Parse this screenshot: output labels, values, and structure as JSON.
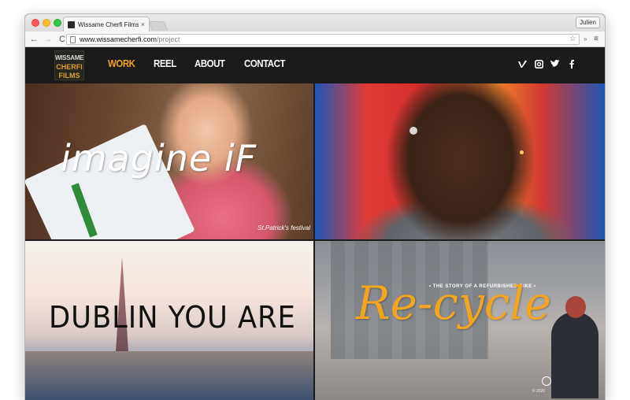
{
  "browser": {
    "tab_title": "Wissame Cherfi Films",
    "tab_close": "×",
    "profile": "Julien",
    "url_domain": "www.wissamecherfi.com",
    "url_path": "/project",
    "back": "←",
    "forward": "→",
    "reload": "C",
    "star": "☆",
    "extensions": "»",
    "menu": "≡"
  },
  "logo": {
    "line1": "WISSAME",
    "line2": "CHERFI",
    "line3": "FILMS"
  },
  "nav": {
    "items": [
      {
        "label": "WORK",
        "active": true
      },
      {
        "label": "REEL",
        "active": false
      },
      {
        "label": "ABOUT",
        "active": false
      },
      {
        "label": "CONTACT",
        "active": false
      }
    ]
  },
  "social": [
    "vimeo-icon",
    "instagram-icon",
    "twitter-icon",
    "facebook-icon"
  ],
  "projects": [
    {
      "title": "imagine iF",
      "badge": "St.Patrick's festival"
    },
    {
      "title": ""
    },
    {
      "title": "DUBLIN YOU ARE"
    },
    {
      "title": "Re-cycle",
      "subtitle": "• THE STORY OF A REFURBISHED BIKE •",
      "credit": "© 2020"
    }
  ],
  "colors": {
    "accent": "#e9a321",
    "header_bg": "#1b1b1b",
    "recycle_title": "#f2a51e"
  }
}
